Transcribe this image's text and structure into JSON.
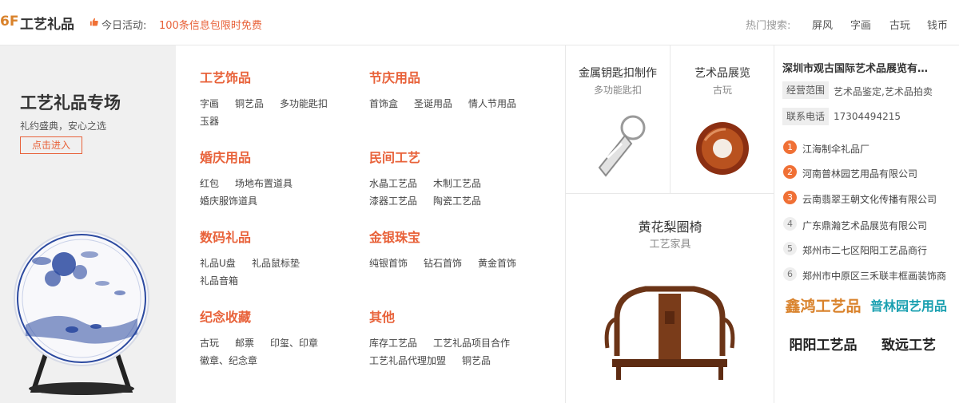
{
  "header": {
    "floor_number": "6F",
    "floor_title": "工艺礼品",
    "activity_label": "今日活动:",
    "activity_link": "100条信息包限时免费",
    "hot_search_label": "热门搜索:",
    "hot_searches": [
      "屏风",
      "字画",
      "古玩",
      "钱币"
    ]
  },
  "banner": {
    "title": "工艺礼品专场",
    "subtitle": "礼约盛典，安心之选",
    "button": "点击进入"
  },
  "categories": [
    {
      "title": "工艺饰品",
      "links": [
        "字画",
        "铜艺品",
        "多功能匙扣",
        "玉器"
      ]
    },
    {
      "title": "节庆用品",
      "links": [
        "首饰盒",
        "圣诞用品",
        "情人节用品"
      ]
    },
    {
      "title": "婚庆用品",
      "links": [
        "红包",
        "场地布置道具",
        "婚庆服饰道具"
      ]
    },
    {
      "title": "民间工艺",
      "links": [
        "水晶工艺品",
        "木制工艺品",
        "漆器工艺品",
        "陶瓷工艺品"
      ]
    },
    {
      "title": "数码礼品",
      "links": [
        "礼品U盘",
        "礼品鼠标垫",
        "礼品音箱"
      ]
    },
    {
      "title": "金银珠宝",
      "links": [
        "纯银首饰",
        "钻石首饰",
        "黄金首饰"
      ]
    },
    {
      "title": "纪念收藏",
      "links": [
        "古玩",
        "邮票",
        "印玺、印章",
        "徽章、纪念章"
      ]
    },
    {
      "title": "其他",
      "links": [
        "库存工艺品",
        "工艺礼品项目合作",
        "工艺礼品代理加盟",
        "铜艺品"
      ]
    }
  ],
  "products": [
    {
      "title": "金属钥匙扣制作",
      "subtitle": "多功能匙扣"
    },
    {
      "title": "艺术品展览",
      "subtitle": "古玩"
    },
    {
      "title": "黄花梨圈椅",
      "subtitle": "工艺家具"
    }
  ],
  "company": {
    "name": "深圳市观古国际艺术品展览有…",
    "scope_label": "经营范围",
    "scope_value": "艺术品鉴定,艺术品拍卖",
    "phone_label": "联系电话",
    "phone_value": "17304494215"
  },
  "ranking": [
    {
      "rank": "1",
      "name": "江海制伞礼品厂"
    },
    {
      "rank": "2",
      "name": "河南普林园艺用品有限公司"
    },
    {
      "rank": "3",
      "name": "云南翡翠王朝文化传播有限公司"
    },
    {
      "rank": "4",
      "name": "广东鼎瀚艺术品展览有限公司"
    },
    {
      "rank": "5",
      "name": "郑州市二七区阳阳工艺品商行"
    },
    {
      "rank": "6",
      "name": "郑州市中原区三禾联丰框画装饰商"
    }
  ],
  "brand_logos": [
    {
      "text": "鑫鸿工艺品",
      "color": "#d9822b"
    },
    {
      "text": "普林园艺用品",
      "color": "#1aa0b0"
    },
    {
      "text": "阳阳工艺品",
      "color": "#222222"
    },
    {
      "text": "致远工艺",
      "color": "#222222"
    }
  ],
  "colors": {
    "accent": "#e8623a",
    "floor": "#d9822b",
    "hot_rank": "#f07035"
  }
}
